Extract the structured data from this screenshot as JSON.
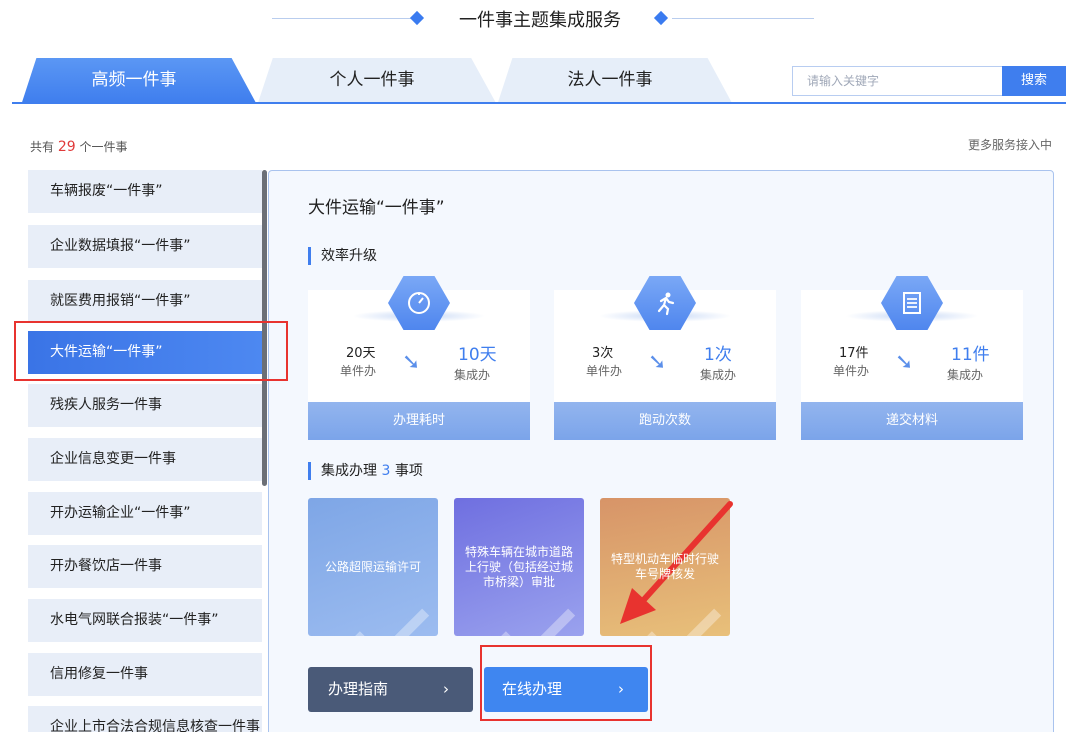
{
  "header": {
    "title": "一件事主题集成服务"
  },
  "tabs": [
    {
      "label": "高频一件事",
      "active": true
    },
    {
      "label": "个人一件事",
      "active": false
    },
    {
      "label": "法人一件事",
      "active": false
    }
  ],
  "search": {
    "placeholder": "请输入关键字",
    "button_label": "搜索"
  },
  "summary": {
    "prefix": "共有",
    "count": "29",
    "suffix": "个一件事",
    "more_label": "更多服务接入中"
  },
  "sidebar": {
    "items": [
      {
        "label": "车辆报废“一件事”"
      },
      {
        "label": "企业数据填报“一件事”"
      },
      {
        "label": "就医费用报销“一件事”"
      },
      {
        "label": "大件运输“一件事”",
        "active": true
      },
      {
        "label": "残疾人服务一件事"
      },
      {
        "label": "企业信息变更一件事"
      },
      {
        "label": "开办运输企业“一件事”"
      },
      {
        "label": "开办餐饮店一件事"
      },
      {
        "label": "水电气网联合报装“一件事”"
      },
      {
        "label": "信用修复一件事"
      },
      {
        "label": "企业上市合法合规信息核查一件事"
      }
    ]
  },
  "detail": {
    "title": "大件运输“一件事”",
    "efficiency_heading": "效率升级",
    "cards": [
      {
        "icon": "stopwatch-icon",
        "before_value": "20天",
        "before_label": "单件办",
        "after_value": "10天",
        "after_label": "集成办",
        "footer": "办理耗时"
      },
      {
        "icon": "running-person-icon",
        "before_value": "3次",
        "before_label": "单件办",
        "after_value": "1次",
        "after_label": "集成办",
        "footer": "跑动次数"
      },
      {
        "icon": "document-icon",
        "before_value": "17件",
        "before_label": "单件办",
        "after_value": "11件",
        "after_label": "集成办",
        "footer": "递交材料"
      }
    ],
    "integrated_heading_prefix": "集成办理",
    "integrated_count": "3",
    "integrated_heading_suffix": "事项",
    "tiles": [
      {
        "label": "公路超限运输许可"
      },
      {
        "label": "特殊车辆在城市道路上行驶（包括经过城市桥梁）审批"
      },
      {
        "label": "特型机动车临时行驶车号牌核发"
      }
    ],
    "guide_button": "办理指南",
    "online_button": "在线办理"
  },
  "colors": {
    "accent": "#3f7eee",
    "annotation": "#e8332f"
  }
}
